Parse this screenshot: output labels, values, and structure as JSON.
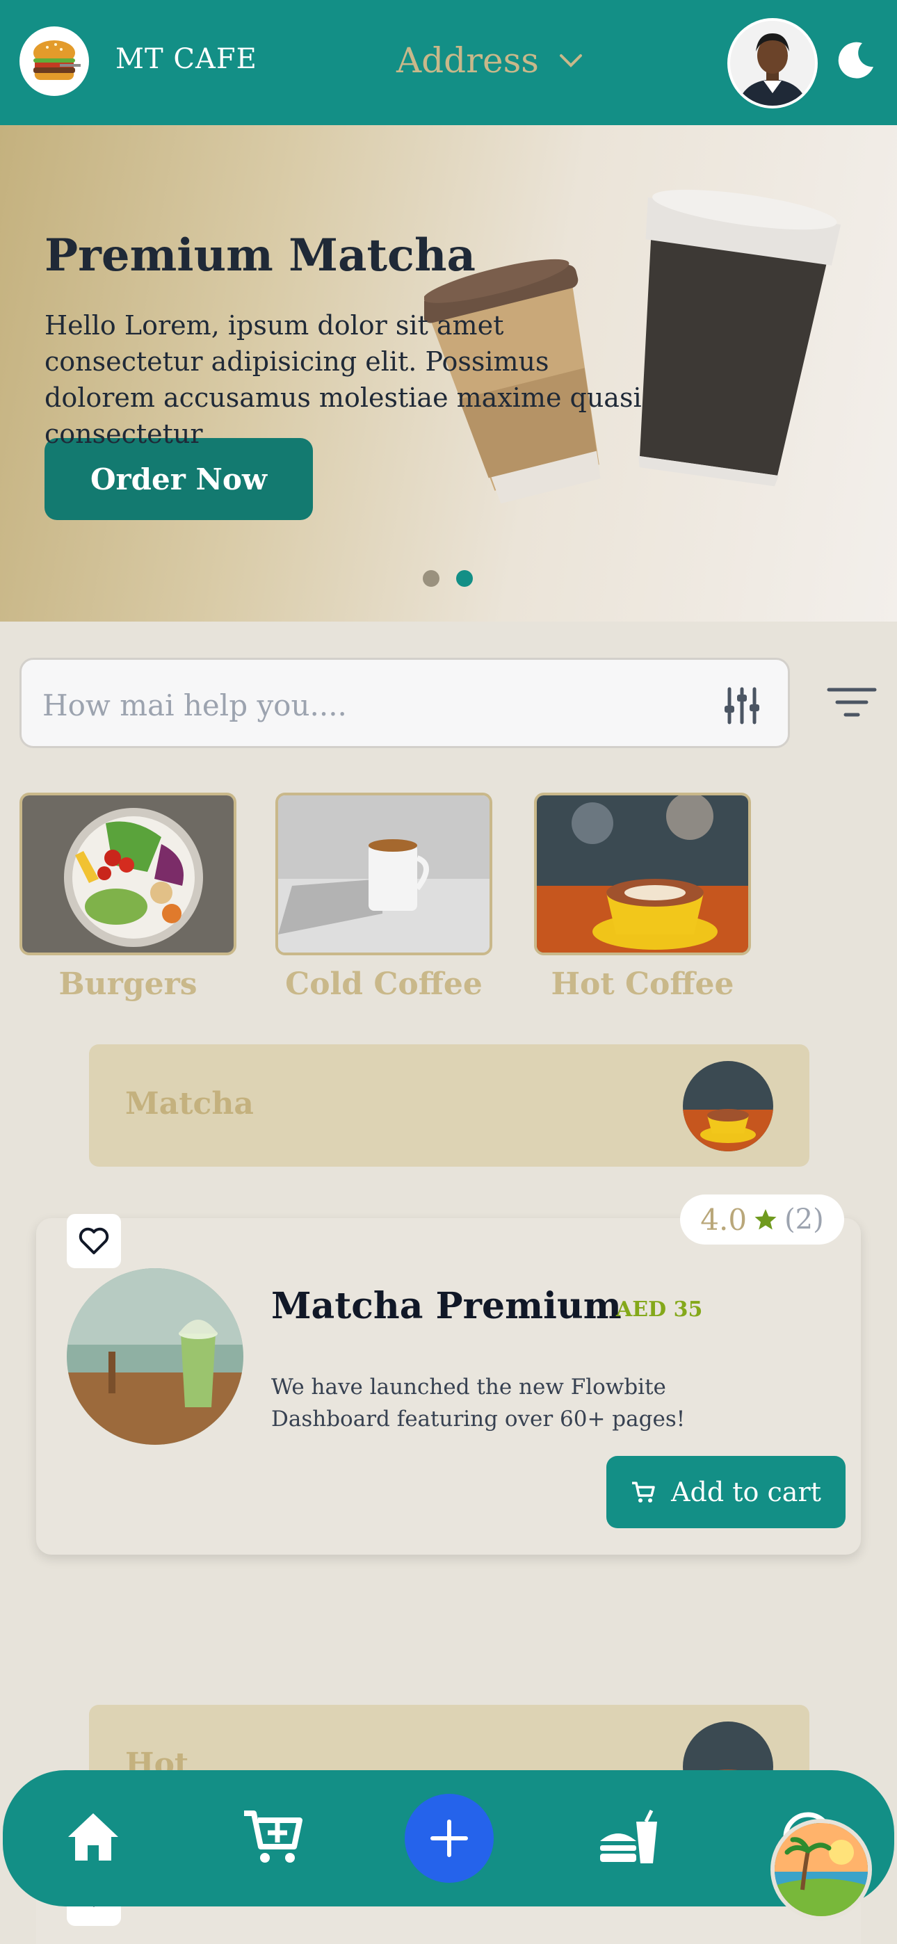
{
  "header": {
    "brand": "MT CAFE",
    "address_label": "Address",
    "logo_icon": "burger-logo",
    "avatar_icon": "user-avatar",
    "theme_icon": "moon-icon"
  },
  "hero": {
    "title": "Premium Matcha",
    "text": "Hello Lorem, ipsum dolor sit amet consectetur adipisicing elit. Possimus dolorem accusamus molestiae maxime quasi consectetur",
    "button_label": "Order Now",
    "slides": 2,
    "active_slide": 2
  },
  "search": {
    "placeholder": "How mai help you...."
  },
  "categories": [
    {
      "label": "Burgers"
    },
    {
      "label": "Cold Coffee"
    },
    {
      "label": "Hot Coffee"
    }
  ],
  "sections": [
    {
      "title": "Matcha"
    },
    {
      "title": "Hot"
    }
  ],
  "product": {
    "rating": "4.0",
    "rating_count": "(2)",
    "name": "Matcha Premium",
    "price": "AED 35",
    "description": "We have launched the new Flowbite Dashboard featuring over 60+ pages!",
    "cart_label": "Add to cart"
  },
  "nav": {
    "items": [
      "home-icon",
      "cart-plus-icon",
      "add-icon",
      "fast-food-icon",
      "help-icon"
    ]
  },
  "colors": {
    "primary": "#138f86",
    "accent": "#c4b17e",
    "price": "#84a81a",
    "fab_blue": "#2563eb"
  }
}
